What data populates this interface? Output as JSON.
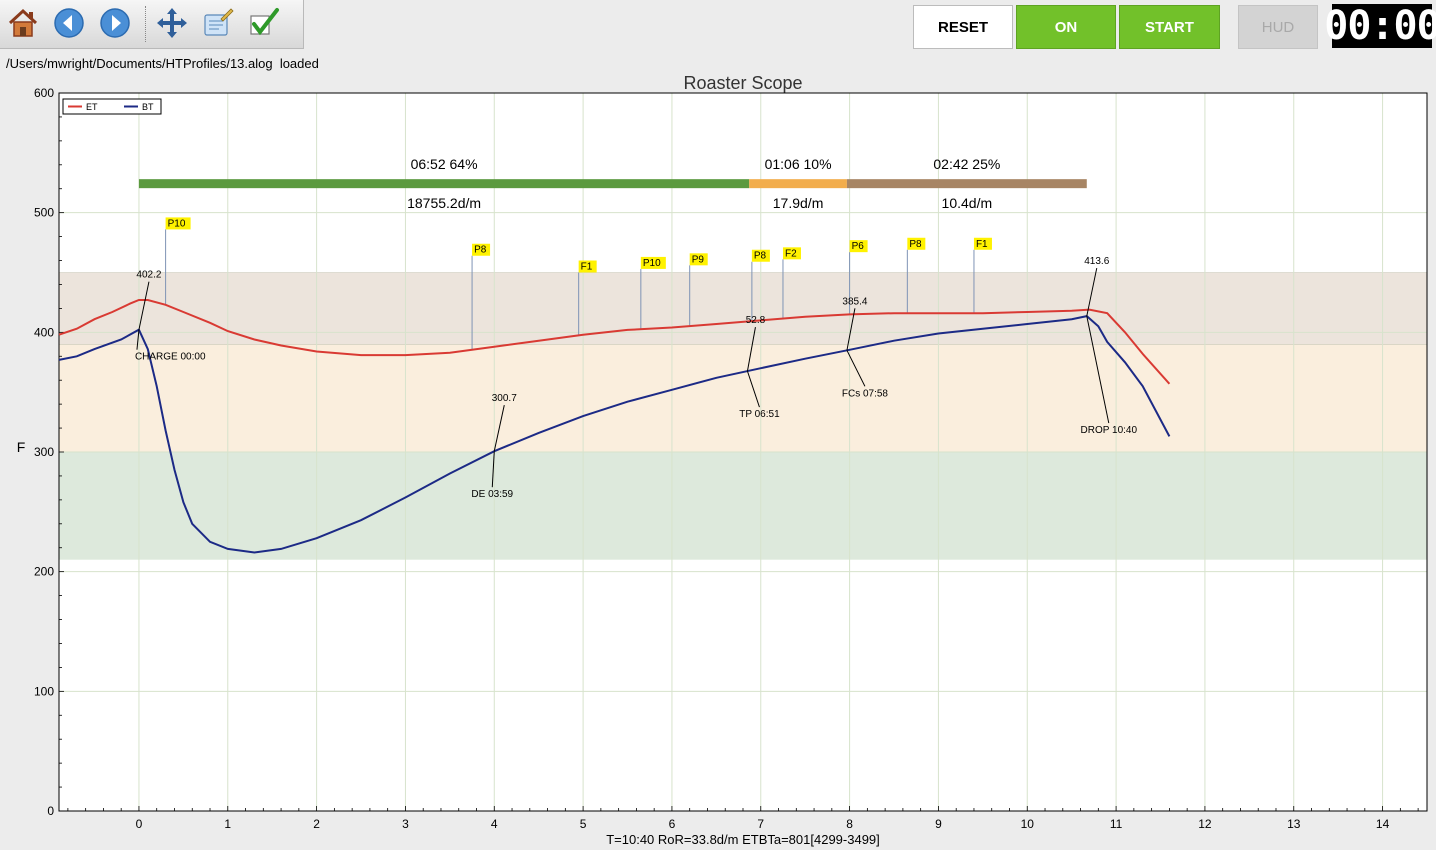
{
  "toolbar": {
    "icons": [
      "home-icon",
      "back-arrow-icon",
      "forward-arrow-icon",
      "move-crosshair-icon",
      "edit-notes-icon",
      "checkmark-icon"
    ],
    "reset_label": "RESET",
    "on_label": "ON",
    "start_label": "START",
    "hud_label": "HUD",
    "timer": "00:00",
    "colors": {
      "on": "#72c12a",
      "start": "#72c12a"
    }
  },
  "status": {
    "message": "/Users/mwright/Documents/HTProfiles/13.alog  loaded"
  },
  "chart_data": {
    "type": "line",
    "title": "Roaster Scope",
    "ylabel": "F",
    "xlim": [
      -0.9,
      14.5
    ],
    "ylim": [
      0,
      600
    ],
    "xticks": [
      0,
      1,
      2,
      3,
      4,
      5,
      6,
      7,
      8,
      9,
      10,
      11,
      12,
      13,
      14
    ],
    "yticks": [
      0,
      100,
      200,
      300,
      400,
      500,
      600
    ],
    "grid": true,
    "legend_position": "top-left",
    "bands": [
      {
        "from": 390,
        "to": 450,
        "color": "#ece4dc"
      },
      {
        "from": 300,
        "to": 390,
        "color": "#faeedd"
      },
      {
        "from": 210,
        "to": 300,
        "color": "#dde9dc"
      }
    ],
    "series": [
      {
        "name": "ET",
        "color": "#d93a33",
        "points": [
          [
            -0.9,
            398
          ],
          [
            -0.7,
            403
          ],
          [
            -0.5,
            411
          ],
          [
            -0.3,
            417
          ],
          [
            -0.1,
            424
          ],
          [
            0,
            427
          ],
          [
            0.1,
            427
          ],
          [
            0.3,
            423
          ],
          [
            0.5,
            417
          ],
          [
            0.8,
            408
          ],
          [
            1.0,
            401
          ],
          [
            1.3,
            394
          ],
          [
            1.6,
            389
          ],
          [
            2.0,
            384
          ],
          [
            2.5,
            381
          ],
          [
            3.0,
            381
          ],
          [
            3.5,
            383
          ],
          [
            4.0,
            388
          ],
          [
            4.5,
            393
          ],
          [
            5.0,
            398
          ],
          [
            5.5,
            402
          ],
          [
            6.0,
            404
          ],
          [
            6.5,
            407
          ],
          [
            7.0,
            410
          ],
          [
            7.5,
            413
          ],
          [
            8.0,
            415
          ],
          [
            8.5,
            416
          ],
          [
            9.0,
            416
          ],
          [
            9.5,
            416
          ],
          [
            10.0,
            417
          ],
          [
            10.5,
            418
          ],
          [
            10.7,
            419
          ],
          [
            10.9,
            416
          ],
          [
            11.1,
            400
          ],
          [
            11.3,
            382
          ],
          [
            11.6,
            357
          ]
        ]
      },
      {
        "name": "BT",
        "color": "#1c2a86",
        "points": [
          [
            -0.9,
            377
          ],
          [
            -0.7,
            380
          ],
          [
            -0.5,
            386
          ],
          [
            -0.2,
            394
          ],
          [
            0,
            402.2
          ],
          [
            0.1,
            386
          ],
          [
            0.2,
            355
          ],
          [
            0.3,
            318
          ],
          [
            0.4,
            285
          ],
          [
            0.5,
            258
          ],
          [
            0.6,
            240
          ],
          [
            0.8,
            225
          ],
          [
            1.0,
            219
          ],
          [
            1.3,
            216
          ],
          [
            1.6,
            219
          ],
          [
            2.0,
            228
          ],
          [
            2.5,
            243
          ],
          [
            3.0,
            262
          ],
          [
            3.5,
            282
          ],
          [
            4.0,
            300.7
          ],
          [
            4.5,
            316
          ],
          [
            5.0,
            330
          ],
          [
            5.5,
            342
          ],
          [
            6.0,
            352
          ],
          [
            6.5,
            362
          ],
          [
            7.0,
            370
          ],
          [
            7.5,
            378
          ],
          [
            8.0,
            385.4
          ],
          [
            8.5,
            393
          ],
          [
            9.0,
            399
          ],
          [
            9.5,
            403
          ],
          [
            10.0,
            407
          ],
          [
            10.5,
            411
          ],
          [
            10.67,
            413.6
          ],
          [
            10.8,
            405
          ],
          [
            10.9,
            392
          ],
          [
            11.1,
            375
          ],
          [
            11.3,
            355
          ],
          [
            11.6,
            313
          ]
        ]
      }
    ],
    "events": [
      {
        "label": "CHARGE 00:00",
        "x": 0,
        "value": "402.2"
      },
      {
        "label": "DE 03:59",
        "x": 4.0,
        "value": "300.7"
      },
      {
        "label": "TP 06:51",
        "x": 6.85,
        "value": "52.8"
      },
      {
        "label": "FCs 07:58",
        "x": 7.97,
        "value": "385.4"
      },
      {
        "label": "DROP 10:40",
        "x": 10.67,
        "value": "413.6"
      }
    ],
    "flags": [
      {
        "label": "P10",
        "x": 0.3
      },
      {
        "label": "P8",
        "x": 3.75
      },
      {
        "label": "F1",
        "x": 4.95
      },
      {
        "label": "P10",
        "x": 5.65
      },
      {
        "label": "P9",
        "x": 6.2
      },
      {
        "label": "P8",
        "x": 6.9
      },
      {
        "label": "F2",
        "x": 7.25
      },
      {
        "label": "P6",
        "x": 8.0
      },
      {
        "label": "P8",
        "x": 8.65
      },
      {
        "label": "F1",
        "x": 9.4
      }
    ],
    "phases": [
      {
        "time": "06:52",
        "pct": "64%",
        "ror": "18755.2d/m",
        "from": 0,
        "to": 6.87,
        "color": "#5b9a3f"
      },
      {
        "time": "01:06",
        "pct": "10%",
        "ror": "17.9d/m",
        "from": 6.87,
        "to": 7.97,
        "color": "#f2ad4c"
      },
      {
        "time": "02:42",
        "pct": "25%",
        "ror": "10.4d/m",
        "from": 7.97,
        "to": 10.67,
        "color": "#a78564"
      }
    ],
    "footer": "T=10:40   RoR=33.8d/m   ETBTa=801[4299-3499]"
  }
}
